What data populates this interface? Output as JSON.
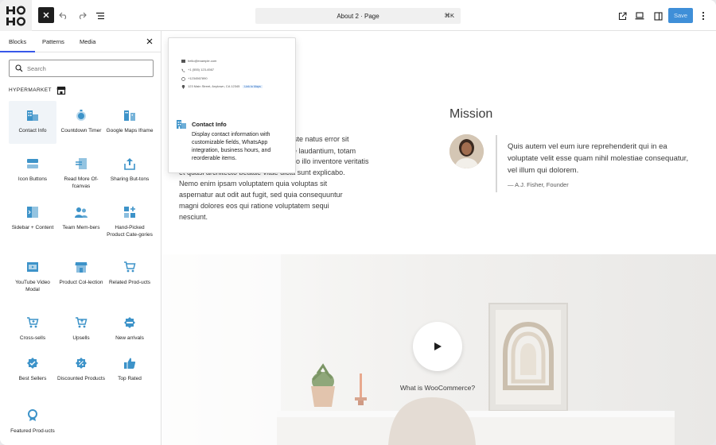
{
  "topbar": {
    "document_title": "About 2 · Page",
    "shortcut": "⌘K",
    "save_label": "Save"
  },
  "sidebar": {
    "tabs": [
      {
        "label": "Blocks",
        "active": true
      },
      {
        "label": "Patterns",
        "active": false
      },
      {
        "label": "Media",
        "active": false
      }
    ],
    "search_placeholder": "Search",
    "category_label": "HYPERMARKET",
    "blocks": [
      {
        "label": "Contact Info",
        "icon": "contact-info-icon",
        "selected": true
      },
      {
        "label": "Countdown Timer",
        "icon": "timer-icon",
        "selected": false
      },
      {
        "label": "Google Maps Iframe",
        "icon": "map-icon",
        "selected": false
      },
      {
        "label": "Icon Buttons",
        "icon": "icon-buttons-icon",
        "selected": false
      },
      {
        "label": "Read More Of-fcanvas",
        "icon": "offcanvas-icon",
        "selected": false
      },
      {
        "label": "Sharing But-tons",
        "icon": "share-icon",
        "selected": false
      },
      {
        "label": "Sidebar + Content",
        "icon": "sidebar-layout-icon",
        "selected": false
      },
      {
        "label": "Team Mem-bers",
        "icon": "team-icon",
        "selected": false
      },
      {
        "label": "Hand-Picked Product Cate-gories",
        "icon": "categories-icon",
        "selected": false
      },
      {
        "label": "YouTube Video Modal",
        "icon": "video-icon",
        "selected": false
      },
      {
        "label": "Product Col-lection",
        "icon": "store-icon",
        "selected": false
      },
      {
        "label": "Related Prod-ucts",
        "icon": "cart-icon",
        "selected": false
      },
      {
        "label": "Cross-sells",
        "icon": "cart-plus-icon",
        "selected": false
      },
      {
        "label": "Upsells",
        "icon": "cart-up-icon",
        "selected": false
      },
      {
        "label": "New arrivals",
        "icon": "new-badge-icon",
        "selected": false
      },
      {
        "label": "Best Sellers",
        "icon": "badge-check-icon",
        "selected": false
      },
      {
        "label": "Discounted Products",
        "icon": "discount-icon",
        "selected": false
      },
      {
        "label": "Top Rated",
        "icon": "thumbs-up-icon",
        "selected": false
      },
      {
        "label": "Featured Prod-ucts",
        "icon": "award-icon",
        "selected": false
      }
    ]
  },
  "popover": {
    "preview_email": "hello@example.com",
    "preview_phone": "+1 (555) 123-4567",
    "preview_whatsapp": "+1234567890",
    "preview_address": "123 Main Street, Anytown, CA 12345",
    "preview_link": "Link to Maps",
    "title": "Contact Info",
    "description": "Display contact information with customizable fields, WhatsApp integration, business hours, and reorderable items."
  },
  "content": {
    "paragraph_lines": [
      "ste natus error sit",
      "nque laudantium, totam",
      "et quasi architecto beatae vitae dicta sunt explicabo.",
      "Nemo enim ipsam voluptatem quia voluptas sit",
      "aspernatur aut odit aut fugit, sed quia consequuntur",
      "magni dolores eos qui ratione voluptatem sequi",
      "nesciunt."
    ],
    "paragraph_fragment": "o illo inventore veritatis",
    "mission_heading": "Mission",
    "quote": "Quis autem vel eum iure reprehenderit qui in ea voluptate velit esse quam nihil molestiae consequatur, vel illum qui dolorem.",
    "cite": "— A.J. Fisher, Founder",
    "video_caption": "What is WooCommerce?"
  },
  "colors": {
    "accent": "#3858e9",
    "save_button": "#3f8fd8",
    "block_icon": "#3d93c9"
  }
}
